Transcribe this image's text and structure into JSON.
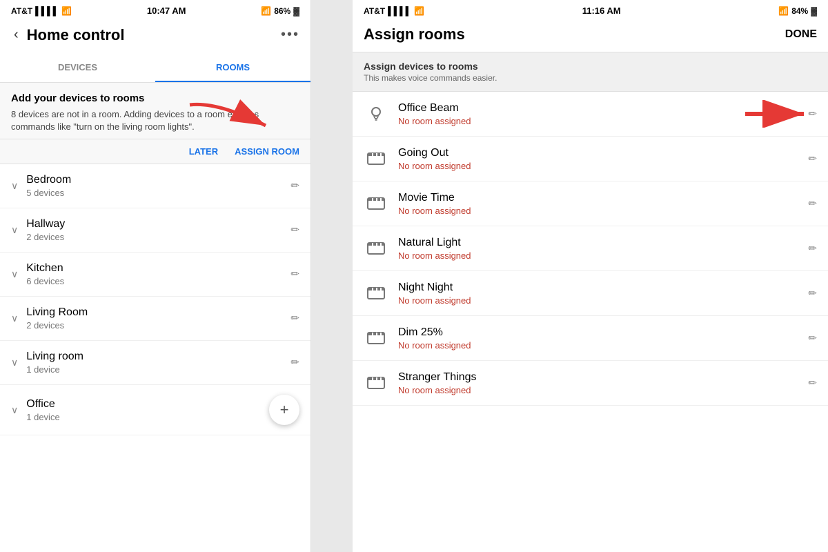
{
  "left": {
    "status": {
      "carrier": "AT&T",
      "time": "10:47 AM",
      "bluetooth_pct": "86%"
    },
    "header": {
      "title": "Home control",
      "back_label": "‹",
      "more_label": "•••"
    },
    "tabs": [
      {
        "label": "DEVICES",
        "active": false
      },
      {
        "label": "ROOMS",
        "active": true
      }
    ],
    "banner": {
      "title": "Add your devices to rooms",
      "desc": "8 devices are not in a room. Adding devices to a room enables commands like \"turn on the living room lights\".",
      "later_label": "LATER",
      "assign_label": "ASSIGN ROOM"
    },
    "rooms": [
      {
        "name": "Bedroom",
        "count": "5 devices"
      },
      {
        "name": "Hallway",
        "count": "2 devices"
      },
      {
        "name": "Kitchen",
        "count": "6 devices"
      },
      {
        "name": "Living Room",
        "count": "2 devices"
      },
      {
        "name": "Living room",
        "count": "1 device"
      },
      {
        "name": "Office",
        "count": "1 device"
      }
    ],
    "fab_label": "+"
  },
  "right": {
    "status": {
      "carrier": "AT&T",
      "time": "11:16 AM",
      "bluetooth_pct": "84%"
    },
    "header": {
      "title": "Assign rooms",
      "done_label": "DONE"
    },
    "subtitle": {
      "title": "Assign devices to rooms",
      "desc": "This makes voice commands easier."
    },
    "devices": [
      {
        "name": "Office Beam",
        "status": "No room assigned",
        "icon": "bulb",
        "has_arrow": true
      },
      {
        "name": "Going Out",
        "status": "No room assigned",
        "icon": "scene"
      },
      {
        "name": "Movie Time",
        "status": "No room assigned",
        "icon": "scene"
      },
      {
        "name": "Natural Light",
        "status": "No room assigned",
        "icon": "scene"
      },
      {
        "name": "Night Night",
        "status": "No room assigned",
        "icon": "scene"
      },
      {
        "name": "Dim 25%",
        "status": "No room assigned",
        "icon": "scene"
      },
      {
        "name": "Stranger Things",
        "status": "No room assigned",
        "icon": "scene"
      }
    ]
  }
}
